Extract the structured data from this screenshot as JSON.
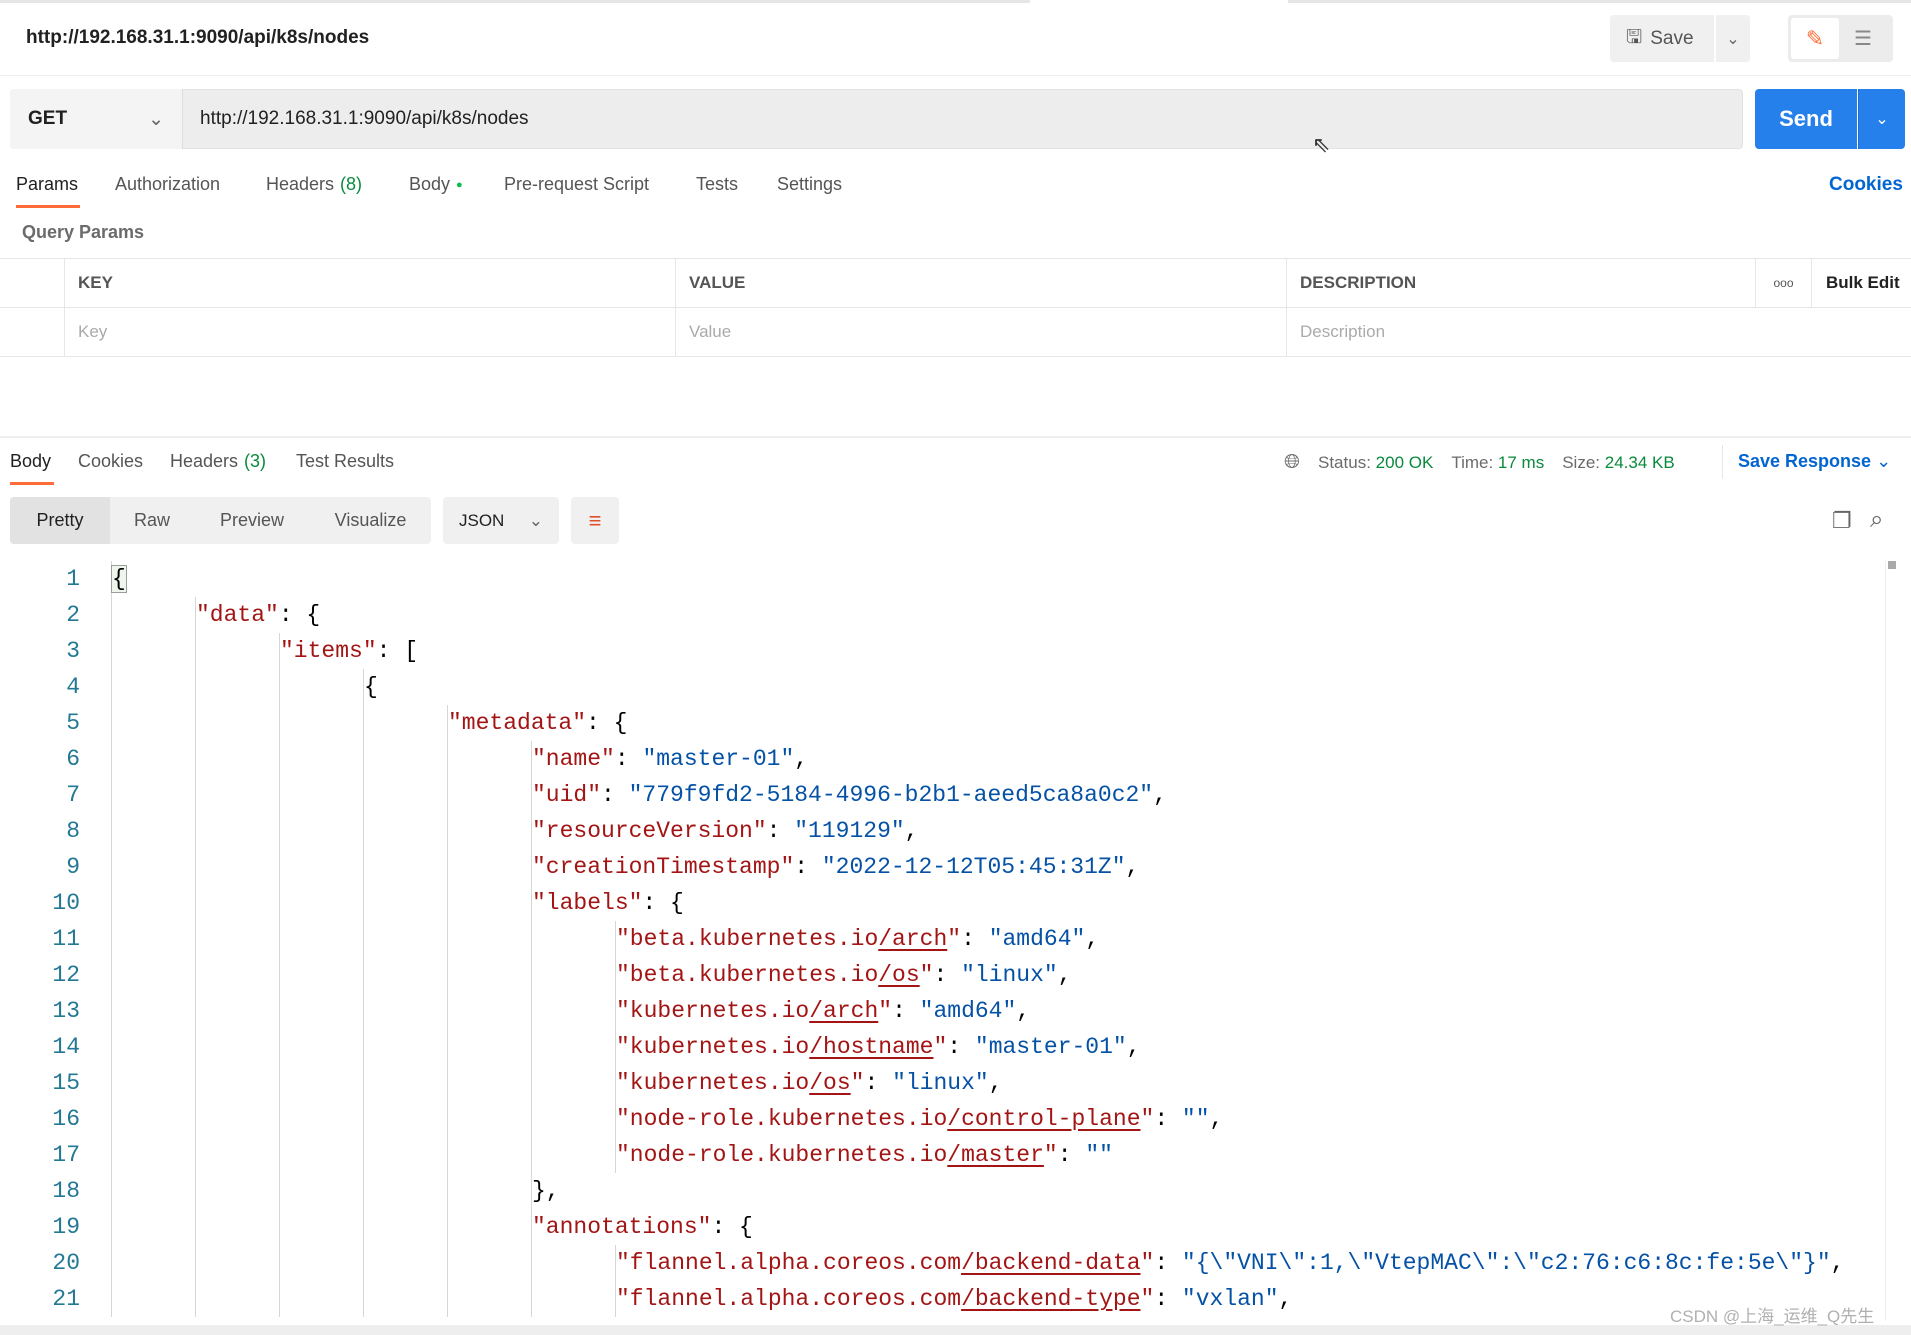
{
  "header": {
    "title": "http://192.168.31.1:9090/api/k8s/nodes",
    "save_label": "Save"
  },
  "request": {
    "method": "GET",
    "url": "http://192.168.31.1:9090/api/k8s/nodes",
    "send_label": "Send"
  },
  "request_tabs": [
    {
      "label": "Params",
      "active": true
    },
    {
      "label": "Authorization"
    },
    {
      "label": "Headers",
      "count": "(8)"
    },
    {
      "label": "Body",
      "dot": true
    },
    {
      "label": "Pre-request Script"
    },
    {
      "label": "Tests"
    },
    {
      "label": "Settings"
    }
  ],
  "cookies_label": "Cookies",
  "query_params": {
    "title": "Query Params",
    "columns": [
      "KEY",
      "VALUE",
      "DESCRIPTION"
    ],
    "more": "ooo",
    "bulk_edit": "Bulk Edit",
    "placeholders": [
      "Key",
      "Value",
      "Description"
    ]
  },
  "response_tabs": [
    {
      "label": "Body",
      "active": true
    },
    {
      "label": "Cookies"
    },
    {
      "label": "Headers",
      "count": "(3)"
    },
    {
      "label": "Test Results"
    }
  ],
  "status": {
    "status_label": "Status:",
    "status": "200 OK",
    "time_label": "Time:",
    "time": "17 ms",
    "size_label": "Size:",
    "size": "24.34 KB",
    "save_response": "Save Response"
  },
  "view_modes": [
    "Pretty",
    "Raw",
    "Preview",
    "Visualize"
  ],
  "format": "JSON",
  "colors": {
    "accent": "#ff6c37",
    "send": "#2680eb",
    "link": "#0265d2",
    "ok": "#0a8a3c",
    "key": "#a31515",
    "string": "#0451a5"
  },
  "code_lines": [
    {
      "i": 0,
      "t": [
        [
          "p",
          "{"
        ]
      ]
    },
    {
      "i": 1,
      "t": [
        [
          "k",
          "\"data\""
        ],
        [
          "p",
          ": {"
        ]
      ]
    },
    {
      "i": 2,
      "t": [
        [
          "k",
          "\"items\""
        ],
        [
          "p",
          ": ["
        ]
      ]
    },
    {
      "i": 3,
      "t": [
        [
          "p",
          "{"
        ]
      ]
    },
    {
      "i": 4,
      "t": [
        [
          "k",
          "\"metadata\""
        ],
        [
          "p",
          ": {"
        ]
      ]
    },
    {
      "i": 5,
      "t": [
        [
          "k",
          "\"name\""
        ],
        [
          "p",
          ": "
        ],
        [
          "s",
          "\"master-01\""
        ],
        [
          "p",
          ","
        ]
      ]
    },
    {
      "i": 5,
      "t": [
        [
          "k",
          "\"uid\""
        ],
        [
          "p",
          ": "
        ],
        [
          "s",
          "\"779f9fd2-5184-4996-b2b1-aeed5ca8a0c2\""
        ],
        [
          "p",
          ","
        ]
      ]
    },
    {
      "i": 5,
      "t": [
        [
          "k",
          "\"resourceVersion\""
        ],
        [
          "p",
          ": "
        ],
        [
          "s",
          "\"119129\""
        ],
        [
          "p",
          ","
        ]
      ]
    },
    {
      "i": 5,
      "t": [
        [
          "k",
          "\"creationTimestamp\""
        ],
        [
          "p",
          ": "
        ],
        [
          "s",
          "\"2022-12-12T05:45:31Z\""
        ],
        [
          "p",
          ","
        ]
      ]
    },
    {
      "i": 5,
      "t": [
        [
          "k",
          "\"labels\""
        ],
        [
          "p",
          ": {"
        ]
      ]
    },
    {
      "i": 6,
      "t": [
        [
          "k",
          "\"beta.kubernetes.io"
        ],
        [
          "ku",
          "/arch"
        ],
        [
          "k",
          "\""
        ],
        [
          "p",
          ": "
        ],
        [
          "s",
          "\"amd64\""
        ],
        [
          "p",
          ","
        ]
      ]
    },
    {
      "i": 6,
      "t": [
        [
          "k",
          "\"beta.kubernetes.io"
        ],
        [
          "ku",
          "/os"
        ],
        [
          "k",
          "\""
        ],
        [
          "p",
          ": "
        ],
        [
          "s",
          "\"linux\""
        ],
        [
          "p",
          ","
        ]
      ]
    },
    {
      "i": 6,
      "t": [
        [
          "k",
          "\"kubernetes.io"
        ],
        [
          "ku",
          "/arch"
        ],
        [
          "k",
          "\""
        ],
        [
          "p",
          ": "
        ],
        [
          "s",
          "\"amd64\""
        ],
        [
          "p",
          ","
        ]
      ]
    },
    {
      "i": 6,
      "t": [
        [
          "k",
          "\"kubernetes.io"
        ],
        [
          "ku",
          "/hostname"
        ],
        [
          "k",
          "\""
        ],
        [
          "p",
          ": "
        ],
        [
          "s",
          "\"master-01\""
        ],
        [
          "p",
          ","
        ]
      ]
    },
    {
      "i": 6,
      "t": [
        [
          "k",
          "\"kubernetes.io"
        ],
        [
          "ku",
          "/os"
        ],
        [
          "k",
          "\""
        ],
        [
          "p",
          ": "
        ],
        [
          "s",
          "\"linux\""
        ],
        [
          "p",
          ","
        ]
      ]
    },
    {
      "i": 6,
      "t": [
        [
          "k",
          "\"node-role.kubernetes.io"
        ],
        [
          "ku",
          "/control-plane"
        ],
        [
          "k",
          "\""
        ],
        [
          "p",
          ": "
        ],
        [
          "s",
          "\"\""
        ],
        [
          "p",
          ","
        ]
      ]
    },
    {
      "i": 6,
      "t": [
        [
          "k",
          "\"node-role.kubernetes.io"
        ],
        [
          "ku",
          "/master"
        ],
        [
          "k",
          "\""
        ],
        [
          "p",
          ": "
        ],
        [
          "s",
          "\"\""
        ]
      ]
    },
    {
      "i": 5,
      "t": [
        [
          "p",
          "},"
        ]
      ]
    },
    {
      "i": 5,
      "t": [
        [
          "k",
          "\"annotations\""
        ],
        [
          "p",
          ": {"
        ]
      ]
    },
    {
      "i": 6,
      "t": [
        [
          "k",
          "\"flannel.alpha.coreos.com"
        ],
        [
          "ku",
          "/backend-data"
        ],
        [
          "k",
          "\""
        ],
        [
          "p",
          ": "
        ],
        [
          "s",
          "\"{\\\"VNI\\\":1,\\\"VtepMAC\\\":\\\"c2:76:c6:8c:fe:5e\\\"}\""
        ],
        [
          "p",
          ","
        ]
      ]
    },
    {
      "i": 6,
      "t": [
        [
          "k",
          "\"flannel.alpha.coreos.com"
        ],
        [
          "ku",
          "/backend-type"
        ],
        [
          "k",
          "\""
        ],
        [
          "p",
          ": "
        ],
        [
          "s",
          "\"vxlan\""
        ],
        [
          "p",
          ","
        ]
      ]
    }
  ],
  "watermark": "CSDN @上海_运维_Q先生"
}
